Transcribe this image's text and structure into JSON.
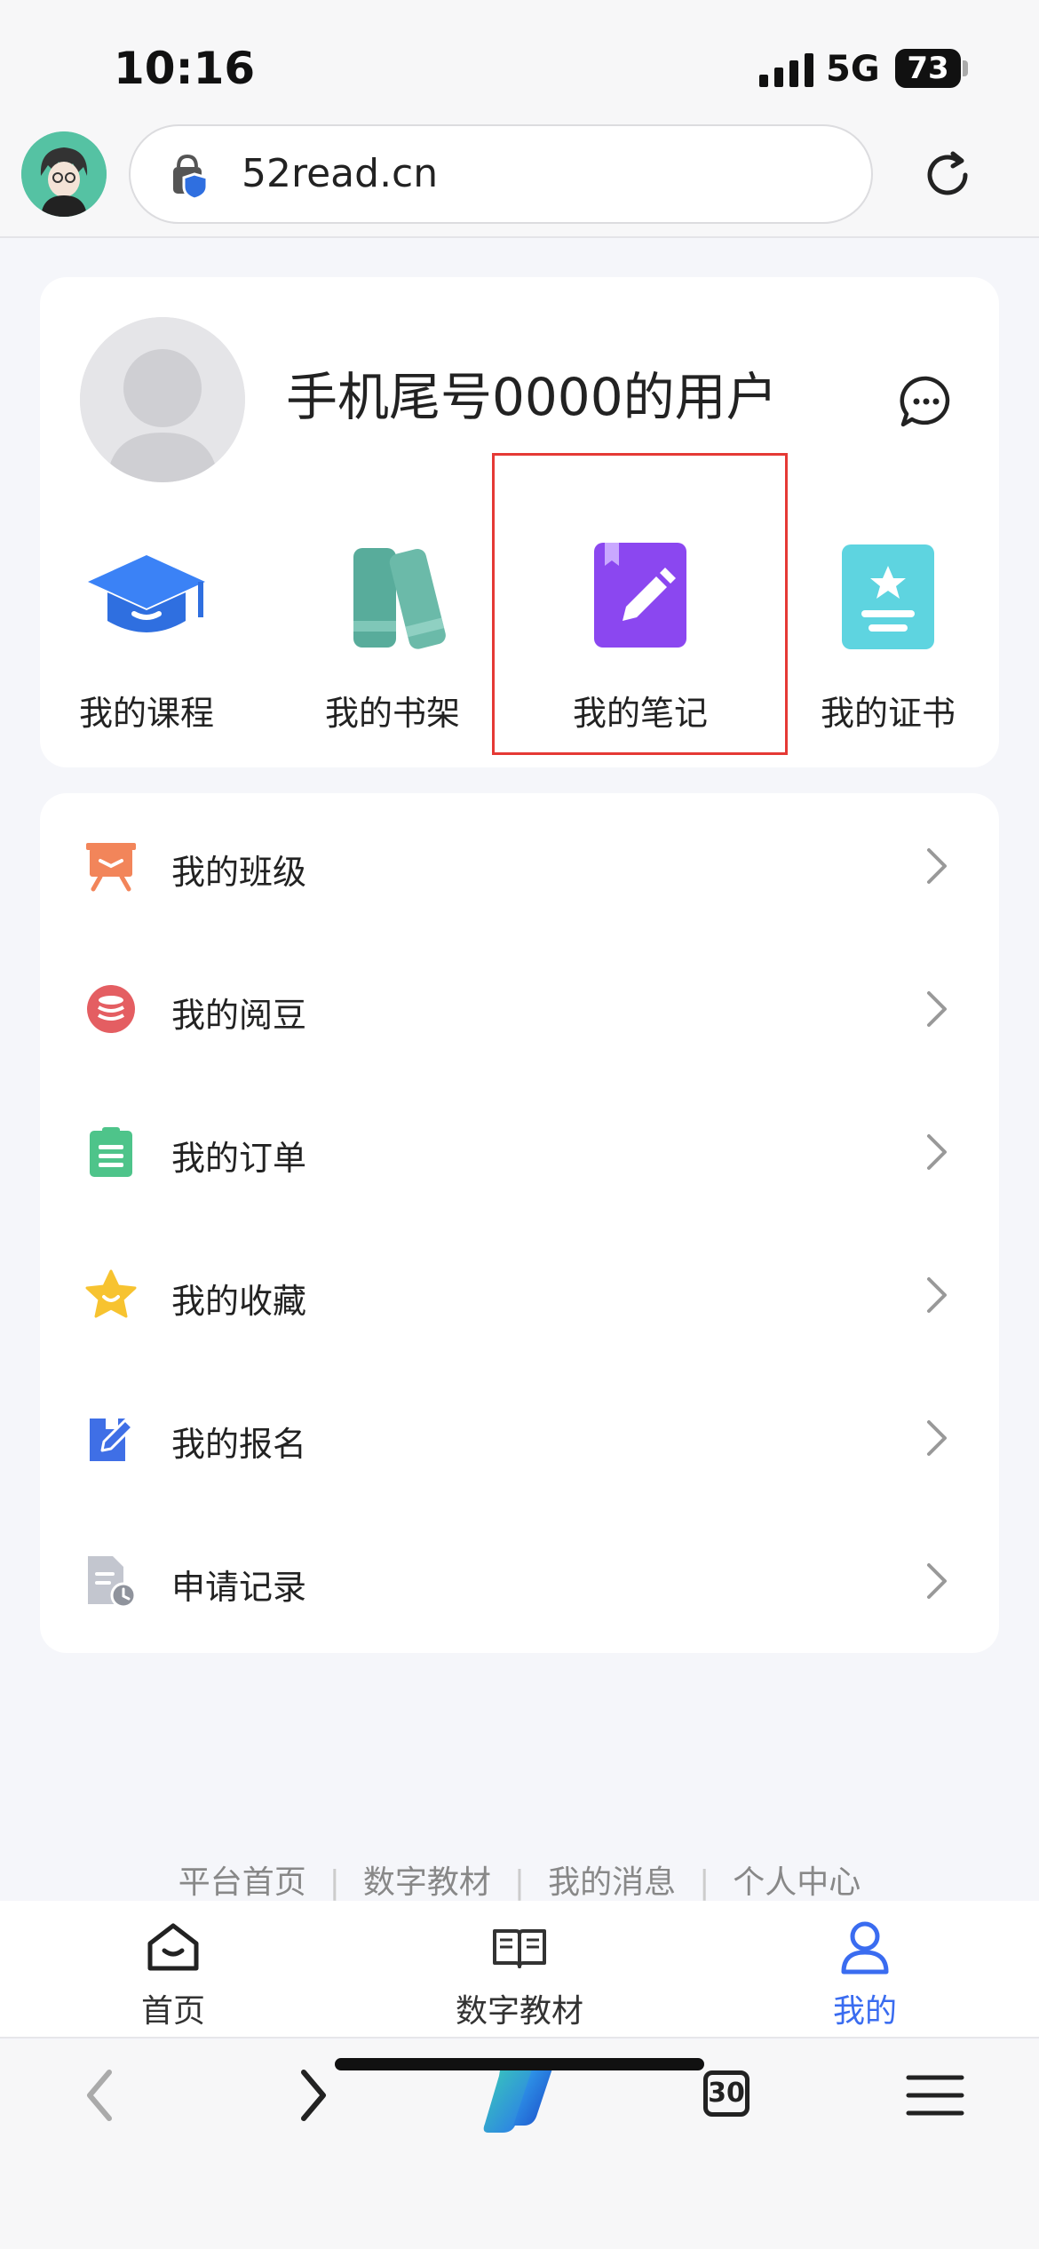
{
  "status_bar": {
    "time": "10:16",
    "network": "5G",
    "battery": "73"
  },
  "browser": {
    "url": "52read.cn",
    "tab_count": "30"
  },
  "profile": {
    "username": "手机尾号0000的用户"
  },
  "quick_actions": [
    {
      "label": "我的课程",
      "icon": "graduation-cap-icon"
    },
    {
      "label": "我的书架",
      "icon": "books-icon"
    },
    {
      "label": "我的笔记",
      "icon": "notebook-pen-icon"
    },
    {
      "label": "我的证书",
      "icon": "certificate-icon"
    }
  ],
  "menu": [
    {
      "label": "我的班级",
      "icon": "class-board-icon"
    },
    {
      "label": "我的阅豆",
      "icon": "coins-icon"
    },
    {
      "label": "我的订单",
      "icon": "order-clipboard-icon"
    },
    {
      "label": "我的收藏",
      "icon": "star-icon"
    },
    {
      "label": "我的报名",
      "icon": "signup-edit-icon"
    },
    {
      "label": "申请记录",
      "icon": "application-record-icon"
    }
  ],
  "footer_links": [
    "平台首页",
    "数字教材",
    "我的消息",
    "个人中心"
  ],
  "tabs": [
    {
      "label": "首页",
      "icon": "home-icon"
    },
    {
      "label": "数字教材",
      "icon": "open-book-icon"
    },
    {
      "label": "我的",
      "icon": "user-icon",
      "active": true
    }
  ],
  "colors": {
    "accent": "#3a6cf0",
    "highlight": "#e53935",
    "note_purple": "#8b47f0"
  }
}
